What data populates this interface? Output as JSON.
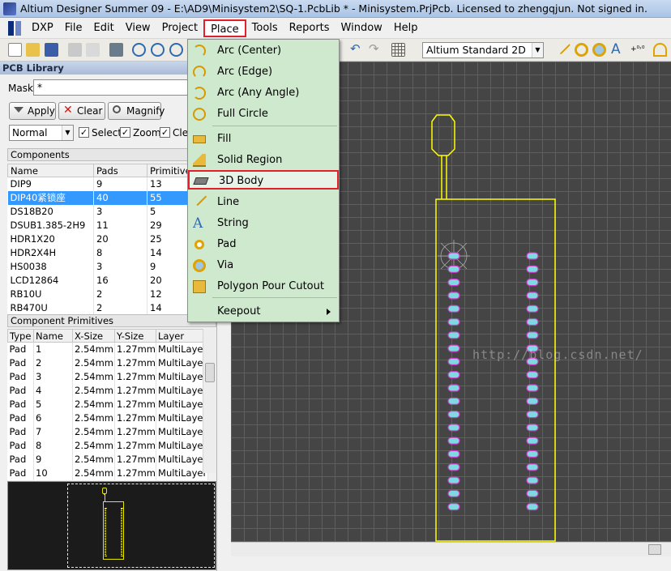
{
  "window": {
    "title": "Altium Designer Summer 09 - E:\\AD9\\Minisystem2\\SQ-1.PcbLib * - Minisystem.PrjPcb. Licensed to zhengqjun. Not signed in."
  },
  "menubar": {
    "items": [
      {
        "label": "DXP"
      },
      {
        "label": "File"
      },
      {
        "label": "Edit"
      },
      {
        "label": "View"
      },
      {
        "label": "Project"
      },
      {
        "label": "Place"
      },
      {
        "label": "Tools"
      },
      {
        "label": "Reports"
      },
      {
        "label": "Window"
      },
      {
        "label": "Help"
      }
    ],
    "active": "Place"
  },
  "toolbar": {
    "view_mode": "Altium Standard 2D"
  },
  "place_menu": {
    "items": [
      {
        "label": "Arc (Center)",
        "icon": "arc-center-icon"
      },
      {
        "label": "Arc (Edge)",
        "icon": "arc-edge-icon"
      },
      {
        "label": "Arc (Any Angle)",
        "icon": "arc-any-angle-icon"
      },
      {
        "label": "Full Circle",
        "icon": "full-circle-icon"
      },
      {
        "label": "Fill",
        "icon": "fill-icon"
      },
      {
        "label": "Solid Region",
        "icon": "solid-region-icon"
      },
      {
        "label": "3D Body",
        "icon": "3d-body-icon",
        "highlighted": true
      },
      {
        "label": "Line",
        "icon": "line-icon"
      },
      {
        "label": "String",
        "icon": "string-icon"
      },
      {
        "label": "Pad",
        "icon": "pad-icon"
      },
      {
        "label": "Via",
        "icon": "via-icon"
      },
      {
        "label": "Polygon Pour Cutout",
        "icon": "polygon-cutout-icon"
      },
      {
        "label": "Keepout",
        "icon": "",
        "submenu": true
      }
    ]
  },
  "pcb_library": {
    "title": "PCB Library",
    "mask_label": "Mask",
    "mask_value": "*",
    "buttons": {
      "apply": "Apply",
      "clear": "Clear",
      "magnify": "Magnify"
    },
    "mode": "Normal",
    "checks": {
      "select": "Select",
      "zoom": "Zoom",
      "clear": "Clea"
    },
    "components": {
      "title": "Components",
      "columns": [
        "Name",
        "Pads",
        "Primitives"
      ],
      "rows": [
        {
          "name": "DIP9",
          "pads": "9",
          "primitives": "13"
        },
        {
          "name": "DIP40紧锁座",
          "pads": "40",
          "primitives": "55",
          "selected": true
        },
        {
          "name": "DS18B20",
          "pads": "3",
          "primitives": "5"
        },
        {
          "name": "DSUB1.385-2H9",
          "pads": "11",
          "primitives": "29"
        },
        {
          "name": "HDR1X20",
          "pads": "20",
          "primitives": "25"
        },
        {
          "name": "HDR2X4H",
          "pads": "8",
          "primitives": "14"
        },
        {
          "name": "HS0038",
          "pads": "3",
          "primitives": "9"
        },
        {
          "name": "LCD12864",
          "pads": "16",
          "primitives": "20"
        },
        {
          "name": "RB10U",
          "pads": "2",
          "primitives": "12"
        },
        {
          "name": "RB470U",
          "pads": "2",
          "primitives": "14"
        }
      ]
    },
    "primitives": {
      "title": "Component Primitives",
      "columns": [
        "Type",
        "Name",
        "X-Size",
        "Y-Size",
        "Layer"
      ],
      "rows": [
        {
          "type": "Pad",
          "name": "1",
          "x": "2.54mm",
          "y": "1.27mm",
          "layer": "MultiLayer"
        },
        {
          "type": "Pad",
          "name": "2",
          "x": "2.54mm",
          "y": "1.27mm",
          "layer": "MultiLayer"
        },
        {
          "type": "Pad",
          "name": "3",
          "x": "2.54mm",
          "y": "1.27mm",
          "layer": "MultiLayer"
        },
        {
          "type": "Pad",
          "name": "4",
          "x": "2.54mm",
          "y": "1.27mm",
          "layer": "MultiLayer"
        },
        {
          "type": "Pad",
          "name": "5",
          "x": "2.54mm",
          "y": "1.27mm",
          "layer": "MultiLayer"
        },
        {
          "type": "Pad",
          "name": "6",
          "x": "2.54mm",
          "y": "1.27mm",
          "layer": "MultiLayer"
        },
        {
          "type": "Pad",
          "name": "7",
          "x": "2.54mm",
          "y": "1.27mm",
          "layer": "MultiLayer"
        },
        {
          "type": "Pad",
          "name": "8",
          "x": "2.54mm",
          "y": "1.27mm",
          "layer": "MultiLayer"
        },
        {
          "type": "Pad",
          "name": "9",
          "x": "2.54mm",
          "y": "1.27mm",
          "layer": "MultiLayer"
        },
        {
          "type": "Pad",
          "name": "10",
          "x": "2.54mm",
          "y": "1.27mm",
          "layer": "MultiLayer"
        }
      ]
    }
  },
  "canvas": {
    "watermark": "http://blog.csdn.net/"
  },
  "colors": {
    "accent_red": "#e0202a",
    "selection_blue": "#3399ff",
    "menu_green": "#cfe9cf",
    "silkscreen_yellow": "#ffff00",
    "pad_cyan": "#7fd9e0",
    "canvas_bg": "#454545"
  }
}
